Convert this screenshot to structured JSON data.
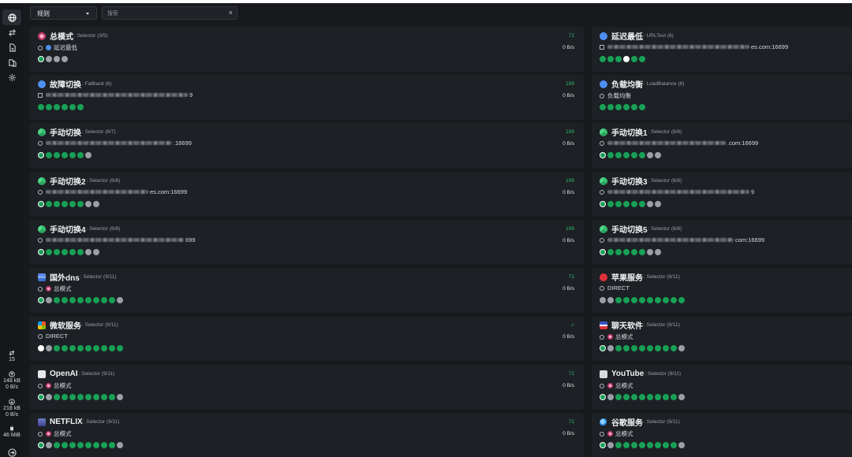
{
  "toolbar": {
    "mode_label": "规则",
    "search_placeholder": "搜索",
    "clear_glyph": "×"
  },
  "sidebar": {
    "nav": [
      {
        "name": "globe-icon",
        "active": true
      },
      {
        "name": "swap-arrows-icon",
        "active": false
      },
      {
        "name": "document-icon",
        "active": false
      },
      {
        "name": "documents-icon",
        "active": false
      },
      {
        "name": "gear-icon",
        "active": false
      }
    ],
    "connections": "15",
    "upload_total": "148 kB",
    "upload_rate": "0 B/s",
    "download_total": "218 kB",
    "download_rate": "0 B/s",
    "memory": "46 MiB"
  },
  "colors": {
    "accent_green": "#18a058",
    "delay_green": "#2fbf71",
    "idle_gray": "#9aa0a6",
    "card_bg": "#1d2024",
    "app_bg": "#17191d"
  },
  "groups": [
    {
      "name": "总模式",
      "type": ": Selector (3/5)",
      "icon": "rosette-icon",
      "now_icon": "arrow-circle-icon",
      "now_prefix_icon": "m-badge-icon",
      "now": "延迟最低",
      "now_blur": 0,
      "delay": "71",
      "rate": "0 B/s",
      "dots": [
        "s",
        "x",
        "x",
        "x"
      ]
    },
    {
      "name": "延迟最低",
      "type": ": URLTest (6)",
      "icon": "m-badge-icon",
      "now_icon": "lock-icon",
      "now_prefix_icon": "",
      "now": "es.com:16699",
      "now_blur": 180,
      "delay": "",
      "rate": "",
      "dots": [
        "g",
        "g",
        "g",
        "w",
        "g",
        "g"
      ]
    },
    {
      "name": "故障切换",
      "type": ": Fallback (6)",
      "icon": "m-badge-icon",
      "now_icon": "lock-icon",
      "now_prefix_icon": "",
      "now": "9",
      "now_blur": 180,
      "delay": "199",
      "rate": "0 B/s",
      "dots": [
        "g",
        "g",
        "g",
        "g",
        "g",
        "g"
      ]
    },
    {
      "name": "负载均衡",
      "type": ": LoadBalance (6)",
      "icon": "m-badge-icon",
      "now_icon": "check-circle-icon",
      "now_prefix_icon": "",
      "now": "负载均衡",
      "now_blur": 0,
      "delay": "",
      "rate": "",
      "dots": [
        "g",
        "g",
        "g",
        "g",
        "g",
        "g"
      ]
    },
    {
      "name": "手动切换",
      "type": ": Selector (6/7)",
      "icon": "recycle-icon",
      "now_icon": "arrow-circle-icon",
      "now_prefix_icon": "",
      "now": ":16699",
      "now_blur": 160,
      "delay": "199",
      "rate": "0 B/s",
      "dots": [
        "s",
        "g",
        "g",
        "g",
        "g",
        "g",
        "x"
      ]
    },
    {
      "name": "手动切换1",
      "type": ": Selector (6/8)",
      "icon": "recycle-icon",
      "now_icon": "arrow-circle-icon",
      "now_prefix_icon": "",
      "now": ".com:16699",
      "now_blur": 150,
      "delay": "",
      "rate": "",
      "dots": [
        "s",
        "g",
        "g",
        "g",
        "g",
        "g",
        "x",
        "x"
      ]
    },
    {
      "name": "手动切换2",
      "type": ": Selector (6/8)",
      "icon": "recycle-icon",
      "now_icon": "arrow-circle-icon",
      "now_prefix_icon": "",
      "now": "es.com:16699",
      "now_blur": 130,
      "delay": "199",
      "rate": "0 B/s",
      "dots": [
        "s",
        "g",
        "g",
        "g",
        "g",
        "g",
        "x",
        "x"
      ]
    },
    {
      "name": "手动切换3",
      "type": ": Selector (6/8)",
      "icon": "recycle-icon",
      "now_icon": "arrow-circle-icon",
      "now_prefix_icon": "",
      "now": "9",
      "now_blur": 180,
      "delay": "",
      "rate": "",
      "dots": [
        "s",
        "g",
        "g",
        "g",
        "g",
        "g",
        "x",
        "x"
      ]
    },
    {
      "name": "手动切换4",
      "type": ": Selector (6/8)",
      "icon": "recycle-icon",
      "now_icon": "arrow-circle-icon",
      "now_prefix_icon": "",
      "now": "699",
      "now_blur": 175,
      "delay": "199",
      "rate": "0 B/s",
      "dots": [
        "s",
        "g",
        "g",
        "g",
        "g",
        "g",
        "x",
        "x"
      ]
    },
    {
      "name": "手动切换5",
      "type": ": Selector (6/8)",
      "icon": "recycle-icon",
      "now_icon": "arrow-circle-icon",
      "now_prefix_icon": "",
      "now": "com:16699",
      "now_blur": 160,
      "delay": "",
      "rate": "",
      "dots": [
        "s",
        "g",
        "g",
        "g",
        "g",
        "g",
        "x",
        "x"
      ]
    },
    {
      "name": "国外dns",
      "type": ": Selector (9/11)",
      "icon": "server-icon",
      "now_icon": "arrow-circle-icon",
      "now_prefix_icon": "rosette-icon",
      "now": "总模式",
      "now_blur": 0,
      "delay": "71",
      "rate": "0 B/s",
      "dots": [
        "s",
        "x",
        "g",
        "g",
        "g",
        "g",
        "g",
        "g",
        "g",
        "g",
        "x"
      ]
    },
    {
      "name": "苹果服务",
      "type": ": Selector (9/11)",
      "icon": "apple-icon",
      "now_icon": "arrow-circle-icon",
      "now_prefix_icon": "",
      "now": "DIRECT",
      "now_blur": 0,
      "delay": "",
      "rate": "",
      "dots": [
        "x",
        "x",
        "g",
        "g",
        "g",
        "g",
        "g",
        "g",
        "g",
        "g",
        "g"
      ]
    },
    {
      "name": "微软服务",
      "type": ": Selector (9/11)",
      "icon": "puzzle-icon",
      "now_icon": "arrow-circle-icon",
      "now_prefix_icon": "",
      "now": "DIRECT",
      "now_blur": 0,
      "delay": "⚡",
      "rate": "0 B/s",
      "dots": [
        "w",
        "x",
        "g",
        "g",
        "g",
        "g",
        "g",
        "g",
        "g",
        "g",
        "g"
      ]
    },
    {
      "name": "聊天软件",
      "type": ": Selector (9/11)",
      "icon": "chat-flag-icon",
      "now_icon": "arrow-circle-icon",
      "now_prefix_icon": "rosette-icon",
      "now": "总模式",
      "now_blur": 0,
      "delay": "",
      "rate": "",
      "dots": [
        "s",
        "x",
        "g",
        "g",
        "g",
        "g",
        "g",
        "g",
        "g",
        "g",
        "x"
      ]
    },
    {
      "name": "OpenAI",
      "type": ": Selector (9/11)",
      "icon": "robot-icon",
      "now_icon": "arrow-circle-icon",
      "now_prefix_icon": "rosette-icon",
      "now": "总模式",
      "now_blur": 0,
      "delay": "71",
      "rate": "0 B/s",
      "dots": [
        "s",
        "x",
        "g",
        "g",
        "g",
        "g",
        "g",
        "g",
        "g",
        "g",
        "x"
      ]
    },
    {
      "name": "YouTube",
      "type": ": Selector (9/11)",
      "icon": "tv-icon",
      "now_icon": "arrow-circle-icon",
      "now_prefix_icon": "rosette-icon",
      "now": "总模式",
      "now_blur": 0,
      "delay": "",
      "rate": "",
      "dots": [
        "s",
        "x",
        "g",
        "g",
        "g",
        "g",
        "g",
        "g",
        "g",
        "g",
        "x"
      ]
    },
    {
      "name": "NETFLIX",
      "type": ": Selector (9/11)",
      "icon": "film-icon",
      "now_icon": "arrow-circle-icon",
      "now_prefix_icon": "rosette-icon",
      "now": "总模式",
      "now_blur": 0,
      "delay": "71",
      "rate": "0 B/s",
      "dots": [
        "s",
        "x",
        "g",
        "g",
        "g",
        "g",
        "g",
        "g",
        "g",
        "g",
        "x"
      ]
    },
    {
      "name": "谷歌服务",
      "type": ": Selector (9/11)",
      "icon": "magnifier-icon",
      "now_icon": "arrow-circle-icon",
      "now_prefix_icon": "rosette-icon",
      "now": "总模式",
      "now_blur": 0,
      "delay": "",
      "rate": "",
      "dots": [
        "s",
        "x",
        "g",
        "g",
        "g",
        "g",
        "g",
        "g",
        "g",
        "g",
        "x"
      ]
    }
  ]
}
